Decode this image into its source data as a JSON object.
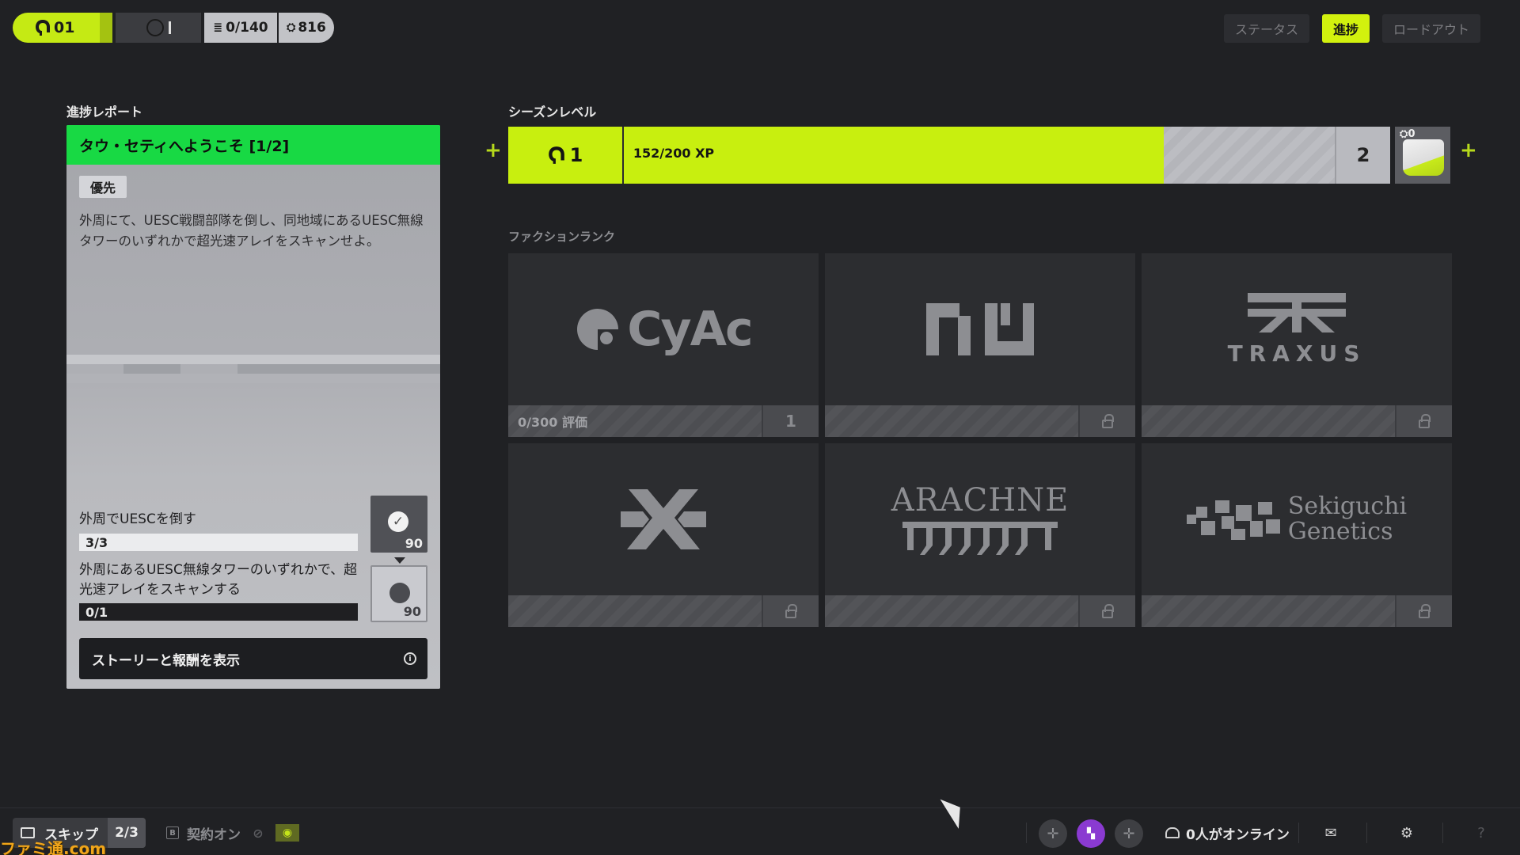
{
  "topbar": {
    "level": "01",
    "pill3_value": "0/140",
    "pill4_value": "816"
  },
  "tabs": [
    {
      "label": "ステータス",
      "active": false
    },
    {
      "label": "進捗",
      "active": true
    },
    {
      "label": "ロードアウト",
      "active": false
    }
  ],
  "report": {
    "section_title": "進捗レポート",
    "heading": "タウ・セティへようこそ [1/2]",
    "priority": "優先",
    "description": "外周にて、UESC戦闘部隊を倒し、同地域にあるUESC無線タワーのいずれかで超光速アレイをスキャンせよ。",
    "objectives": [
      {
        "label": "外周でUESCを倒す",
        "progress": "3/3",
        "fraction": 1.0,
        "reward": "90",
        "completed": true
      },
      {
        "label": "外周にあるUESC無線タワーのいずれかで、超光速アレイをスキャンする",
        "progress": "0/1",
        "fraction": 0.0,
        "reward": "90",
        "completed": false
      }
    ],
    "story_button": "ストーリーと報酬を表示"
  },
  "season": {
    "section_title": "シーズンレベル",
    "level": "1",
    "xp_text": "152/200 XP",
    "xp_fraction": 0.76,
    "next_level": "2",
    "reward_count": "0"
  },
  "factions": {
    "section_title": "ファクションランク",
    "cards": [
      {
        "name": "CyAc",
        "footer": "0/300 評価",
        "rank": "1",
        "locked": false
      },
      {
        "name": "NuCaloric",
        "footer": "",
        "locked": true
      },
      {
        "name": "TRAXUS",
        "footer": "",
        "locked": true
      },
      {
        "name": "MIDA",
        "footer": "",
        "locked": true
      },
      {
        "name": "ARACHNE",
        "footer": "",
        "locked": true
      },
      {
        "name": "Sekiguchi Genetics",
        "footer": "",
        "locked": true
      }
    ],
    "logo_text": {
      "cyac": "CyAc",
      "traxus": "TRAXUS",
      "arachne": "ARACHNE",
      "sekiguchi_1": "Sekiguchi",
      "sekiguchi_2": "Genetics"
    }
  },
  "bottom": {
    "skip_label": "スキップ",
    "skip_count": "2/3",
    "contract_key": "B",
    "contract_label": "契約オン",
    "online_label": "0人がオンライン"
  },
  "watermark": "ファミ通.com",
  "colors": {
    "accent": "#c8ef0f",
    "report_header": "#18d944",
    "background": "#202124"
  }
}
